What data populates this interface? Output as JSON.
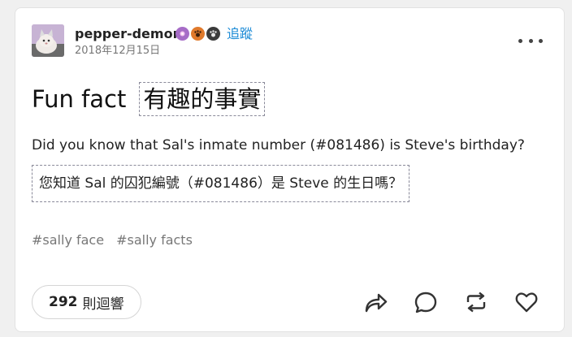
{
  "post": {
    "author": "pepper-demon",
    "follow": "追蹤",
    "date": "2018年12月15日",
    "title_en": "Fun fact",
    "title_zh": "有趣的事實",
    "body_en": "Did you know that Sal's inmate number (#081486) is Steve's birthday?",
    "body_zh": "您知道 Sal 的囚犯編號（#081486）是 Steve 的生日嗎？",
    "tags": [
      "#sally face",
      "#sally facts"
    ]
  },
  "footer": {
    "notes_count": "292",
    "notes_label": "則迴響"
  },
  "colors": {
    "accent": "#1a8ad6",
    "badge1": "#a66cc7",
    "badge2": "#e07a2c",
    "badge3": "#3b3b3b"
  },
  "icons": {
    "badges": [
      "pink-flower-badge-icon",
      "paw-badge-icon",
      "dark-paw-badge-icon"
    ],
    "actions": [
      "share-icon",
      "reply-icon",
      "reblog-icon",
      "like-icon"
    ]
  }
}
